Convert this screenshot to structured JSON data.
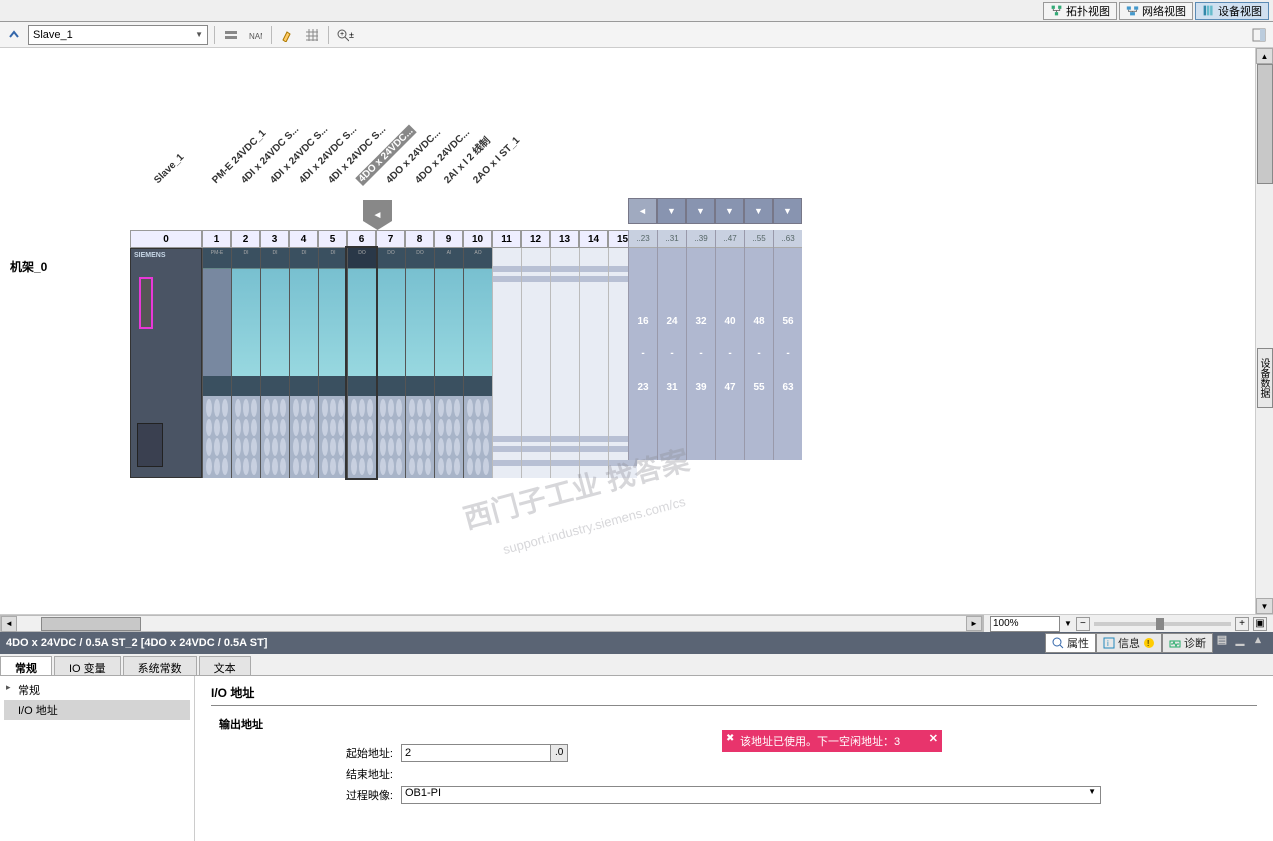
{
  "view_bar": {
    "topo": "拓扑视图",
    "net": "网络视图",
    "dev": "设备视图"
  },
  "toolbar": {
    "device": "Slave_1",
    "zoom_ctrl": "⊕⇆"
  },
  "rack": {
    "name_label": "Slave_1",
    "rack_label": "机架_0",
    "siemens": "SIEMENS",
    "module_labels": [
      "PM-E 24VDC_1",
      "4DI x 24VDC S...",
      "4DI x 24VDC S...",
      "4DI x 24VDC S...",
      "4DI x 24VDC S...",
      "4DO x 24VDC...",
      "4DO x 24VDC...",
      "4DO x 24VDC...",
      "2AI x I 2 线制",
      "2AO x I ST_1"
    ],
    "slots": [
      "0",
      "1",
      "2",
      "3",
      "4",
      "5",
      "6",
      "7",
      "8",
      "9",
      "10",
      "11",
      "12",
      "13",
      "14",
      "15"
    ],
    "ext_headers": [
      "..23",
      "..31",
      "..39",
      "..47",
      "..55",
      "..63"
    ],
    "ext_top": [
      "16",
      "24",
      "32",
      "40",
      "48",
      "56"
    ],
    "ext_mid": [
      "-",
      "-",
      "-",
      "-",
      "-",
      "-"
    ],
    "ext_bot": [
      "23",
      "31",
      "39",
      "47",
      "55",
      "63"
    ]
  },
  "watermark": {
    "main": "西门子工业  找答案",
    "sub": "support.industry.siemens.com/cs"
  },
  "zoom": {
    "value": "100%"
  },
  "prop": {
    "title": "4DO x 24VDC / 0.5A ST_2 [4DO x 24VDC / 0.5A ST]",
    "tab_prop": "属性",
    "tab_info": "信息",
    "tab_diag": "诊断",
    "tabs": {
      "general": "常规",
      "iovar": "IO 变量",
      "sysconst": "系统常数",
      "text": "文本"
    },
    "tree": {
      "general": "常规",
      "ioaddr": "I/O 地址"
    },
    "content": {
      "header": "I/O 地址",
      "sub": "输出地址",
      "start_label": "起始地址:",
      "start_value": "2",
      "start_suffix": ".0",
      "end_label": "结束地址:",
      "img_label": "过程映像:",
      "img_value": "OB1-PI"
    },
    "error": "该地址已使用。下一空闲地址：3"
  },
  "vtab": "设备数据"
}
